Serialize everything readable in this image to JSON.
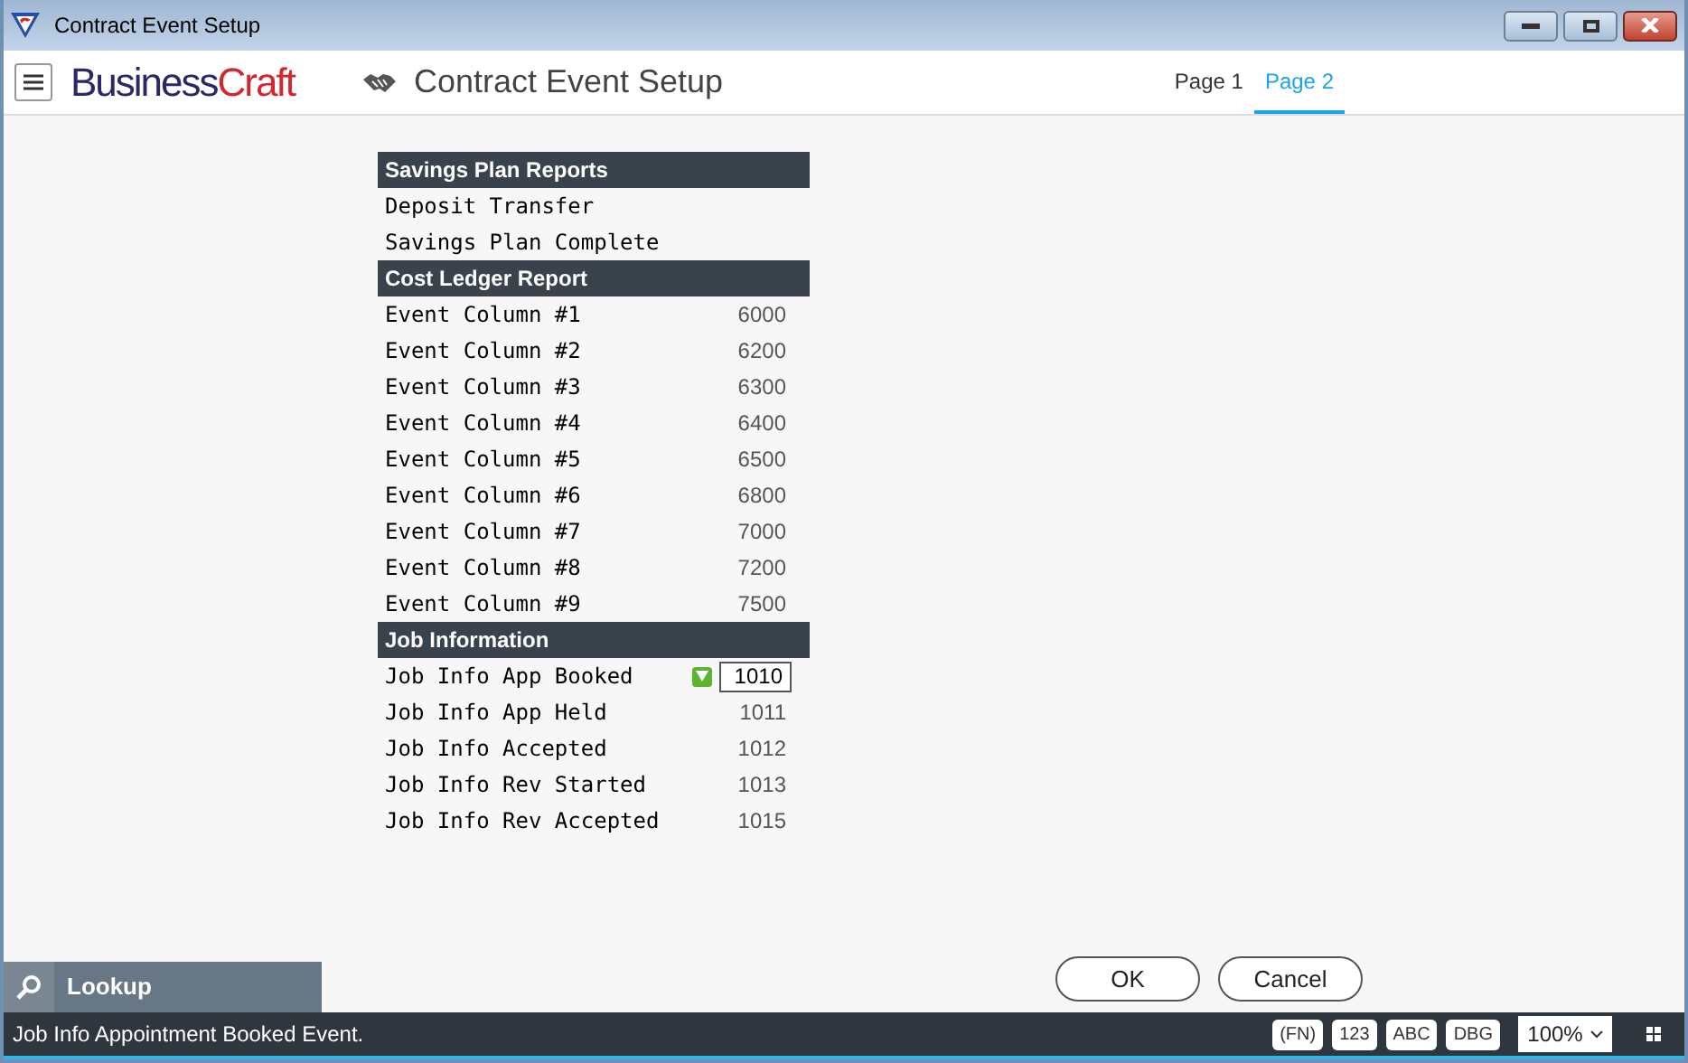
{
  "window": {
    "title": "Contract Event Setup"
  },
  "header": {
    "brand_dark": "Business",
    "brand_red": "Craft",
    "title": "Contract Event Setup"
  },
  "tabs": [
    {
      "label": "Page 1",
      "selected": false
    },
    {
      "label": "Page 2",
      "selected": true
    }
  ],
  "sections": [
    {
      "title": "Savings Plan Reports",
      "rows": [
        {
          "label": "Deposit Transfer",
          "kind": "label"
        },
        {
          "label": "Savings Plan Complete",
          "kind": "label"
        }
      ]
    },
    {
      "title": "Cost Ledger Report",
      "rows": [
        {
          "label": "Event Column #1",
          "value": "6000",
          "kind": "text"
        },
        {
          "label": "Event Column #2",
          "value": "6200",
          "kind": "text"
        },
        {
          "label": "Event Column #3",
          "value": "6300",
          "kind": "text"
        },
        {
          "label": "Event Column #4",
          "value": "6400",
          "kind": "text"
        },
        {
          "label": "Event Column #5",
          "value": "6500",
          "kind": "text"
        },
        {
          "label": "Event Column #6",
          "value": "6800",
          "kind": "text"
        },
        {
          "label": "Event Column #7",
          "value": "7000",
          "kind": "text"
        },
        {
          "label": "Event Column #8",
          "value": "7200",
          "kind": "text"
        },
        {
          "label": "Event Column #9",
          "value": "7500",
          "kind": "text"
        }
      ]
    },
    {
      "title": "Job Information",
      "rows": [
        {
          "label": "Job Info App Booked",
          "value": "1010",
          "kind": "input"
        },
        {
          "label": "Job Info App Held",
          "value": "1011",
          "kind": "text"
        },
        {
          "label": "Job Info Accepted",
          "value": "1012",
          "kind": "text"
        },
        {
          "label": "Job Info Rev Started",
          "value": "1013",
          "kind": "text"
        },
        {
          "label": "Job Info Rev Accepted",
          "value": "1015",
          "kind": "text"
        }
      ]
    }
  ],
  "lookup": {
    "label": "Lookup"
  },
  "buttons": [
    "OK",
    "Cancel"
  ],
  "status_bar": {
    "message": "Job Info Appointment Booked Event.",
    "indicators": [
      "(FN)",
      "123",
      "ABC",
      "DBG"
    ],
    "zoom": "100%"
  }
}
